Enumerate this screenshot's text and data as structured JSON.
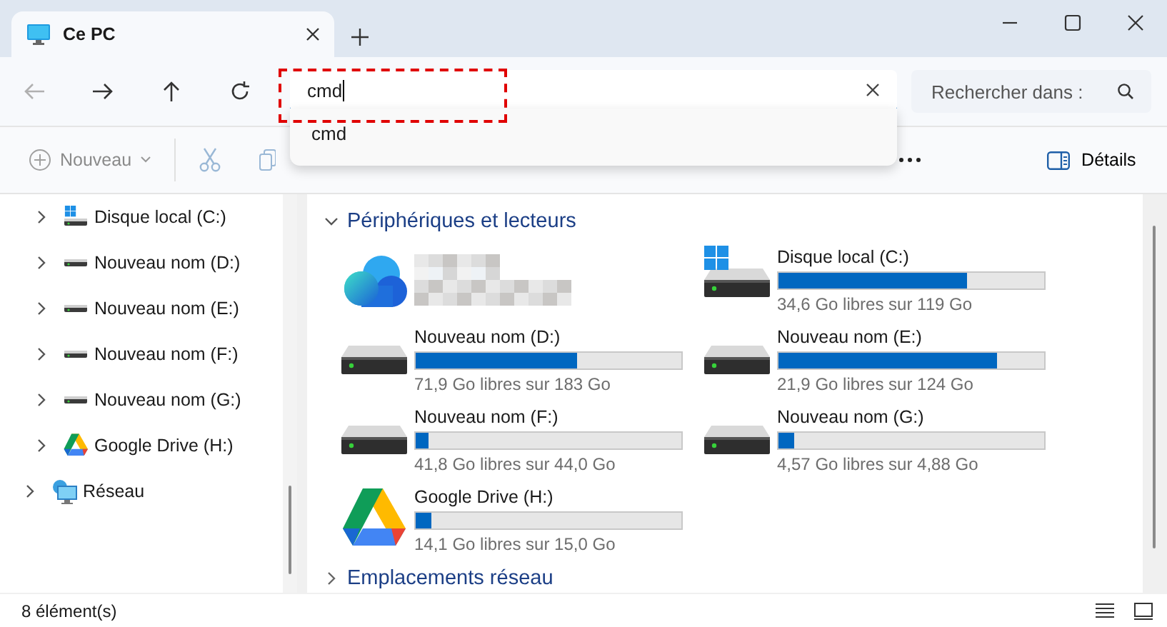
{
  "tabs": [
    {
      "label": "Ce PC",
      "selected": true
    }
  ],
  "navigation": {
    "back": {
      "disabled": true
    }
  },
  "address_bar": {
    "value": "cmd"
  },
  "suggestions": [
    "cmd"
  ],
  "search": {
    "placeholder": "Rechercher dans :"
  },
  "command_bar": {
    "new_button": "Nouveau",
    "details_button": "Détails"
  },
  "sidebar": {
    "items": [
      {
        "children": [
          {
            "label": "Disque local (C:)",
            "kind": "system",
            "expanded": false
          },
          {
            "label": "Nouveau nom (D:)",
            "kind": "disk",
            "expanded": false
          },
          {
            "label": "Nouveau nom (E:)",
            "kind": "disk",
            "expanded": false
          },
          {
            "label": "Nouveau nom (F:)",
            "kind": "disk",
            "expanded": false
          },
          {
            "label": "Nouveau nom (G:)",
            "kind": "disk",
            "expanded": false
          },
          {
            "label": "Google Drive (H:)",
            "kind": "gdrive",
            "expanded": false
          }
        ]
      },
      {
        "label": "Réseau",
        "kind": "network",
        "expanded": false
      }
    ]
  },
  "sections": [
    {
      "title": "Périphériques et lecteurs",
      "expanded": true,
      "drives": [
        {
          "kind": "cloud"
        },
        {
          "kind": "system",
          "name": "Disque local (C:)",
          "level": 0.71,
          "reading": "34,6 Go libres sur 119 Go"
        },
        {
          "kind": "disk",
          "name": "Nouveau nom (D:)",
          "level": 0.61,
          "reading": "71,9 Go libres sur 183 Go"
        },
        {
          "kind": "disk",
          "name": "Nouveau nom (E:)",
          "level": 0.82,
          "reading": "21,9 Go libres sur 124 Go"
        },
        {
          "kind": "disk",
          "name": "Nouveau nom (F:)",
          "level": 0.05,
          "reading": "41,8 Go libres sur 44,0 Go"
        },
        {
          "kind": "disk",
          "name": "Nouveau nom (G:)",
          "level": 0.06,
          "reading": "4,57 Go libres sur 4,88 Go"
        },
        {
          "kind": "gdrive",
          "name": "Google Drive (H:)",
          "level": 0.06,
          "reading": "14,1 Go libres sur 15,0 Go"
        }
      ]
    },
    {
      "title": "Emplacements réseau",
      "expanded": false
    }
  ],
  "status_bar": {
    "count": "8 élément(s)"
  }
}
